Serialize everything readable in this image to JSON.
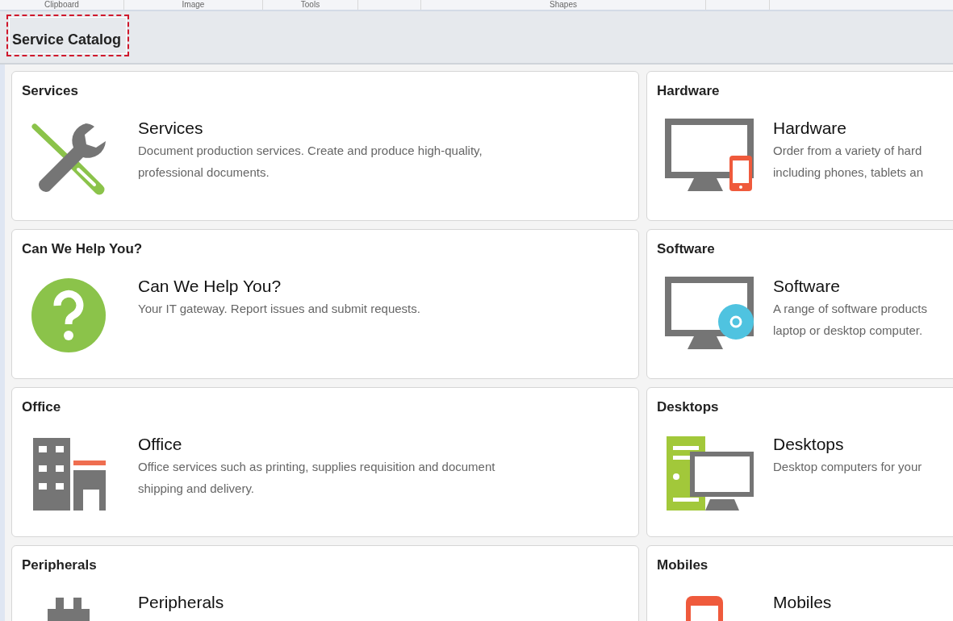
{
  "ribbon": {
    "groups": [
      {
        "label": "Clipboard"
      },
      {
        "label": "Image"
      },
      {
        "label": "Tools"
      },
      {
        "label": "Shapes"
      }
    ]
  },
  "header": {
    "title": "Service Catalog",
    "selected": true
  },
  "cards": [
    {
      "heading": "Services",
      "title": "Services",
      "description": "Document production services. Create and produce high-quality,\nprofessional documents."
    },
    {
      "heading": "Hardware",
      "title": "Hardware",
      "description": "Order from a variety of hard\nincluding phones, tablets an"
    },
    {
      "heading": "Can We Help You?",
      "title": "Can We Help You?",
      "description": "Your IT gateway. Report issues and submit requests."
    },
    {
      "heading": "Software",
      "title": "Software",
      "description": "A range of software products\nlaptop or desktop computer."
    },
    {
      "heading": "Office",
      "title": "Office",
      "description": "Office services such as printing, supplies requisition and document\nshipping and delivery."
    },
    {
      "heading": "Desktops",
      "title": "Desktops",
      "description": "Desktop computers for your"
    },
    {
      "heading": "Peripherals",
      "title": "Peripherals"
    },
    {
      "heading": "Mobiles",
      "title": "Mobiles"
    }
  ]
}
